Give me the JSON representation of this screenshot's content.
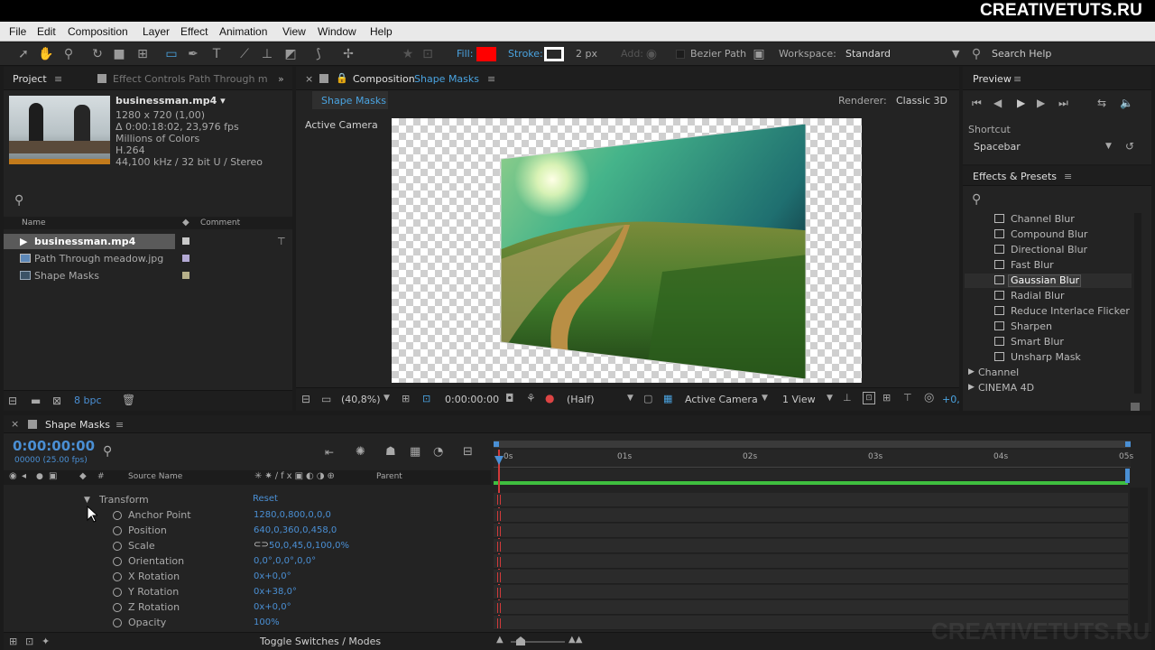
{
  "brand": "CREATIVETUTS.RU",
  "watermark": "CREATIVETUTS.RU",
  "menu": [
    "File",
    "Edit",
    "Composition",
    "Layer",
    "Effect",
    "Animation",
    "View",
    "Window",
    "Help"
  ],
  "toolbar": {
    "fill_label": "Fill:",
    "fill_color": "#ff0000",
    "stroke_label": "Stroke:",
    "stroke_width": "2 px",
    "add_label": "Add:",
    "bezier_label": "Bezier Path",
    "workspace_label": "Workspace:",
    "workspace_value": "Standard",
    "search_help": "Search Help"
  },
  "project": {
    "tab": "Project",
    "tab2": "Effect Controls Path Through m",
    "file_name": "businessman.mp4 ▾",
    "info": [
      "1280 x 720 (1,00)",
      "Δ 0:00:18:02, 23,976 fps",
      "Millions of Colors",
      "H.264",
      "44,100 kHz / 32 bit U / Stereo"
    ],
    "col_name": "Name",
    "col_comment": "Comment",
    "items": [
      {
        "name": "businessman.mp4",
        "color": "#c9c9c9"
      },
      {
        "name": "Path Through meadow.jpg",
        "color": "#b3a9d4"
      },
      {
        "name": "Shape Masks",
        "color": "#b6b08a"
      }
    ],
    "bpc": "8 bpc"
  },
  "composition": {
    "tab_prefix": "Composition",
    "tab_name": "Shape Masks",
    "subtab": "Shape Masks",
    "renderer_label": "Renderer:",
    "renderer_value": "Classic 3D",
    "camera_label": "Active Camera",
    "zoom": "(40,8%)",
    "timecode": "0:00:00:00",
    "resolution": "(Half)",
    "view_camera": "Active Camera",
    "view_count": "1 View",
    "offset": "+0,"
  },
  "preview": {
    "title": "Preview",
    "shortcut_label": "Shortcut",
    "shortcut_value": "Spacebar"
  },
  "effects": {
    "title": "Effects & Presets",
    "items": [
      "Channel Blur",
      "Compound Blur",
      "Directional Blur",
      "Fast Blur",
      "Gaussian Blur",
      "Radial Blur",
      "Reduce Interlace Flicker",
      "Sharpen",
      "Smart Blur",
      "Unsharp Mask"
    ],
    "selected": "Gaussian Blur",
    "groups": [
      "Channel",
      "CINEMA 4D"
    ]
  },
  "timeline": {
    "tab": "Shape Masks",
    "timecode": "0:00:00:00",
    "frames": "00000 (25.00 fps)",
    "col_source": "Source Name",
    "col_parent": "Parent",
    "group": "Transform",
    "reset": "Reset",
    "props": [
      {
        "name": "Anchor Point",
        "value": "1280,0,800,0,0,0"
      },
      {
        "name": "Position",
        "value": "640,0,360,0,458,0"
      },
      {
        "name": "Scale",
        "value": "50,0,45,0,100,0%"
      },
      {
        "name": "Orientation",
        "value": "0,0°,0,0°,0,0°"
      },
      {
        "name": "X Rotation",
        "value": "0x+0,0°"
      },
      {
        "name": "Y Rotation",
        "value": "0x+38,0°"
      },
      {
        "name": "Z Rotation",
        "value": "0x+0,0°"
      },
      {
        "name": "Opacity",
        "value": "100%"
      }
    ],
    "ruler": [
      "0s",
      "01s",
      "02s",
      "03s",
      "04s",
      "05s"
    ],
    "toggle_label": "Toggle Switches / Modes"
  }
}
